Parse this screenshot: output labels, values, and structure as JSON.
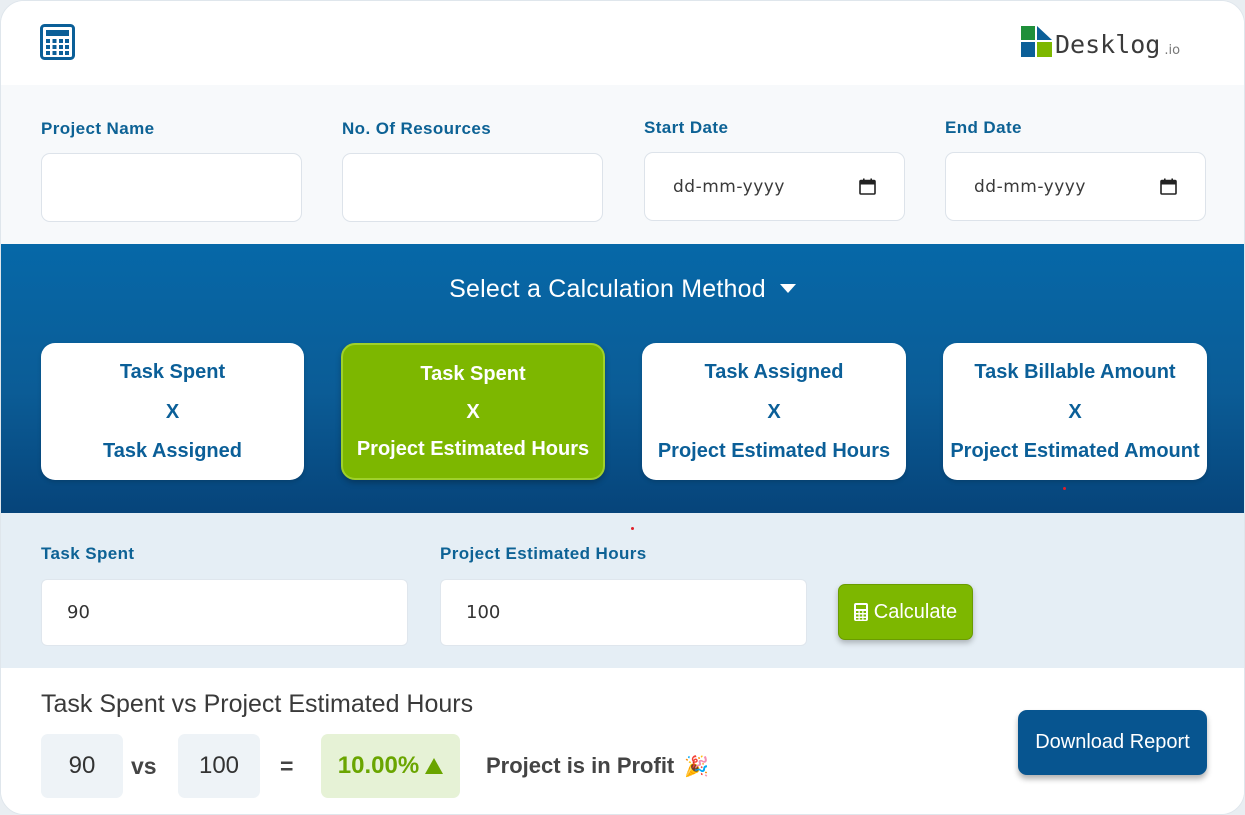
{
  "brand": {
    "logo_text": "Desklog",
    "logo_suffix": ".io"
  },
  "fields": {
    "project_name_label": "Project Name",
    "resources_label": "No. Of Resources",
    "start_date_label": "Start Date",
    "start_date_placeholder": "dd-mm-yyyy",
    "end_date_label": "End Date",
    "end_date_placeholder": "dd-mm-yyyy"
  },
  "method": {
    "title": "Select a Calculation Method",
    "options": [
      {
        "top": "Task Spent",
        "op": "X",
        "bottom": "Task Assigned",
        "active": false
      },
      {
        "top": "Task Spent",
        "op": "X",
        "bottom": "Project Estimated Hours",
        "active": true
      },
      {
        "top": "Task Assigned",
        "op": "X",
        "bottom": "Project Estimated Hours",
        "active": false
      },
      {
        "top": "Task Billable Amount",
        "op": "X",
        "bottom": "Project Estimated Amount",
        "active": false
      }
    ]
  },
  "calc_inputs": {
    "task_spent_label": "Task Spent",
    "task_spent_value": "90",
    "estimated_hours_label": "Project Estimated Hours",
    "estimated_hours_value": "100",
    "calculate_label": "Calculate"
  },
  "result": {
    "title": "Task Spent vs Project Estimated Hours",
    "left_value": "90",
    "vs_label": "vs",
    "right_value": "100",
    "equals_label": "=",
    "percentage": "10.00%",
    "status_text": "Project is in Profit",
    "status_emoji": "🎉",
    "download_label": "Download Report"
  },
  "colors": {
    "primary_blue": "#0b5f98",
    "accent_green": "#7db700",
    "profit_green": "#6aa500"
  }
}
